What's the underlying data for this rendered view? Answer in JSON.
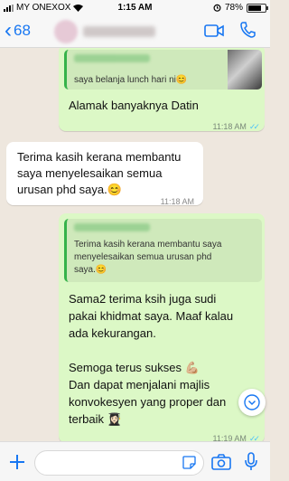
{
  "status_bar": {
    "carrier": "MY ONEXOX",
    "time": "1:15 AM",
    "battery": "78%",
    "battery_level": 0.78
  },
  "header": {
    "back_count": "68",
    "icons": [
      "back-chevron-icon",
      "video-call-icon",
      "phone-call-icon"
    ]
  },
  "messages": [
    {
      "id": "m1",
      "direction": "outgoing",
      "quote_text": "saya belanja lunch hari ni😊",
      "text": "Alamak banyaknya Datin",
      "time": "11:18 AM",
      "ticks": "✓✓"
    },
    {
      "id": "m2",
      "direction": "incoming",
      "text": "Terima kasih kerana membantu\nsaya menyelesaikan semua\nurusan phd saya.😊",
      "time": "11:18 AM"
    },
    {
      "id": "m3",
      "direction": "outgoing",
      "quote_text": "Terima kasih kerana membantu saya\nmenyelesaikan semua urusan phd\nsaya.😊",
      "text": "Sama2 terima ksih juga sudi\npakai khidmat saya. Maaf kalau\nada kekurangan.\n\nSemoga terus sukses 💪🏼\nDan dapat menjalani majlis\nkonvokesyen yang proper dan\nterbaik 👩🏻‍🎓",
      "time": "11:19 AM",
      "ticks": "✓✓"
    }
  ],
  "input_bar": {
    "placeholder": "",
    "icons": [
      "plus-icon",
      "sticker-icon",
      "camera-icon",
      "microphone-icon"
    ]
  },
  "colors": {
    "accent": "#1877f2",
    "outgoing_bubble": "#dcf8c6",
    "incoming_bubble": "#ffffff",
    "chat_background": "#eee7de",
    "read_ticks": "#4fc3f7"
  }
}
